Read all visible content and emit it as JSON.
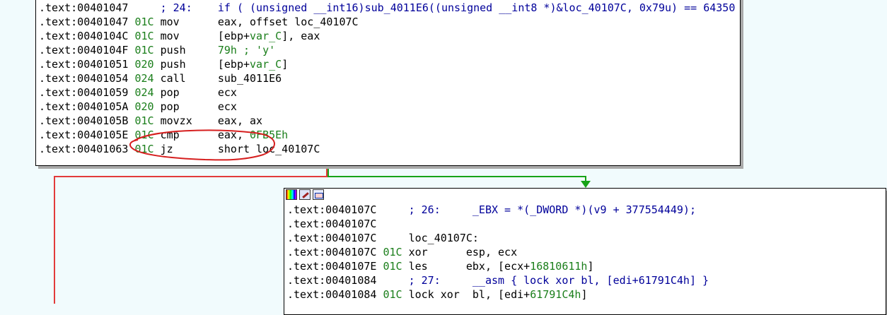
{
  "node_a": {
    "lines": [
      {
        "addr": ".text:00401047",
        "comment": "     ; 24:    if ( (unsigned __int16)sub_4011E6((unsigned __int8 *)&loc_40107C, 0x79u) == 64350 )"
      },
      {
        "addr": ".text:00401047",
        "sp": " 01C",
        "mn": " mov     ",
        "op_pre": "eax, offset loc_40107C"
      },
      {
        "addr": ".text:0040104C",
        "sp": " 01C",
        "mn": " mov     ",
        "op_pre": "[ebp+",
        "op_var": "var_C",
        "op_post": "], eax"
      },
      {
        "addr": ".text:0040104F",
        "sp": " 01C",
        "mn": " push    ",
        "op_num": "79h",
        "op_cm": " ; 'y'"
      },
      {
        "addr": ".text:00401051",
        "sp": " 020",
        "mn": " push    ",
        "op_pre": "[ebp+",
        "op_var": "var_C",
        "op_post": "]"
      },
      {
        "addr": ".text:00401054",
        "sp": " 024",
        "mn": " call    ",
        "op_pre": "sub_4011E6"
      },
      {
        "addr": ".text:00401059",
        "sp": " 024",
        "mn": " pop     ",
        "op_pre": "ecx"
      },
      {
        "addr": ".text:0040105A",
        "sp": " 020",
        "mn": " pop     ",
        "op_pre": "ecx"
      },
      {
        "addr": ".text:0040105B",
        "sp": " 01C",
        "mn": " movzx   ",
        "op_pre": "eax, ax"
      },
      {
        "addr": ".text:0040105E",
        "sp": " 01C",
        "mn": " cmp     ",
        "op_pre": "eax, ",
        "op_num": "0FB5Eh"
      },
      {
        "addr": ".text:00401063",
        "sp": " 01C",
        "mn": " jz      ",
        "op_pre": "short loc_40107C"
      }
    ]
  },
  "node_b": {
    "lines": [
      {
        "addr": ".text:0040107C",
        "comment": "     ; 26:     _EBX = *(_DWORD *)(v9 + 377554449);"
      },
      {
        "addr": ".text:0040107C"
      },
      {
        "addr": ".text:0040107C",
        "label": "     loc_40107C:"
      },
      {
        "addr": ".text:0040107C",
        "sp": " 01C",
        "mn": " xor     ",
        "op_pre": "esp, ecx"
      },
      {
        "addr": ".text:0040107E",
        "sp": " 01C",
        "mn": " les     ",
        "op_pre": "ebx, [ecx+",
        "op_num": "16810611h",
        "op_post": "]"
      },
      {
        "addr": ".text:00401084",
        "comment": "     ; 27:     __asm { lock xor bl, [edi+61791C4h] }"
      },
      {
        "addr": ".text:00401084",
        "sp": " 01C",
        "mn": " lock xor",
        "op_pre": " bl, [edi+",
        "op_num": "61791C4h",
        "op_post": "]"
      }
    ]
  },
  "colors": {
    "stack_pointer": "#1a7e1a",
    "comment": "#00009a",
    "edge_false": "#e23b3b",
    "edge_true": "#17a317",
    "annotation": "#d61f1f"
  }
}
